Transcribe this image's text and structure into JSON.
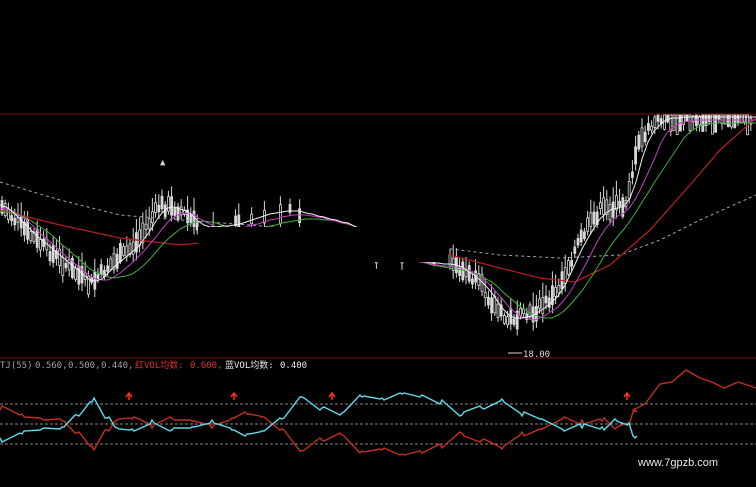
{
  "colors": {
    "background": "#000000",
    "divider": "#7a1010",
    "candle": "#d8d8d8",
    "ma_white": "#f0f0f0",
    "ma_purple": "#c040c0",
    "ma_green": "#40b040",
    "ma_red": "#b02020",
    "ma_dashed": "#9aa8b8",
    "osc_cyan": "#60d8e8",
    "osc_red": "#c03020",
    "arrow": "#ff3020",
    "ref_line": "#888888",
    "label_gray": "#a0a0a0",
    "label_red": "#e03030",
    "label_white": "#e8e8e8"
  },
  "price_panel": {
    "low_marker_label": "18.00"
  },
  "indicator_panel": {
    "name": "TJ(55)",
    "level1": "0.560,",
    "level2": "0.500,",
    "level3": "0.440,",
    "red_label": "红VOL均数:",
    "red_value": "0.600,",
    "blue_label": "蓝VOL均数:",
    "blue_value": "0.400",
    "signal_icons": [
      "up-arrow-icon",
      "up-arrow-icon",
      "up-arrow-icon",
      "up-arrow-icon"
    ]
  },
  "watermark": {
    "text": "www.7gpzb.com"
  }
}
